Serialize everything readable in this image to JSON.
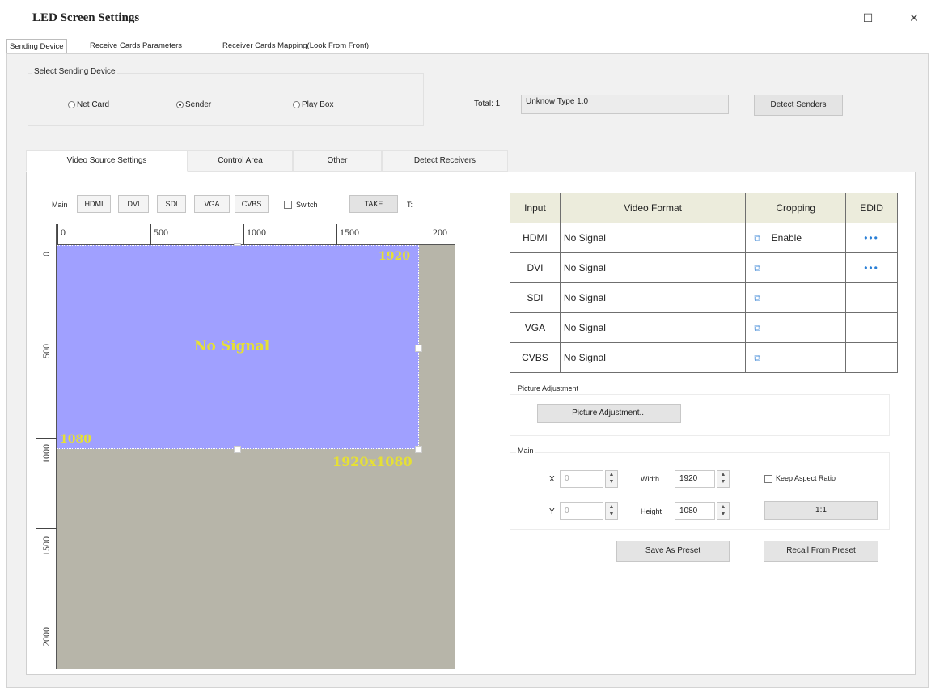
{
  "window": {
    "title": "LED Screen Settings",
    "restore_glyph": "☐",
    "close_glyph": "✕"
  },
  "top_tabs": [
    {
      "label": "Sending Device",
      "active": true
    },
    {
      "label": "Receive Cards Parameters",
      "active": false
    },
    {
      "label": "Receiver Cards Mapping(Look From Front)",
      "active": false
    }
  ],
  "select_sending": {
    "label": "Select Sending Device",
    "options": [
      {
        "label": "Net Card",
        "selected": false
      },
      {
        "label": "Sender",
        "selected": true
      },
      {
        "label": "Play Box",
        "selected": false
      }
    ]
  },
  "total": {
    "label": "Total: 1",
    "value": "Unknow Type 1.0"
  },
  "detect_senders_label": "Detect Senders",
  "sub_tabs": [
    {
      "label": "Video Source Settings",
      "active": true
    },
    {
      "label": "Control Area",
      "active": false
    },
    {
      "label": "Other",
      "active": false
    },
    {
      "label": "Detect Receivers",
      "active": false
    }
  ],
  "source_bar": {
    "main_label": "Main",
    "buttons": [
      "HDMI",
      "DVI",
      "SDI",
      "VGA",
      "CVBS"
    ],
    "switch_label": "Switch",
    "take_label": "TAKE",
    "t_label": "T:"
  },
  "preview": {
    "ruler_h": [
      "0",
      "500",
      "1000",
      "1500",
      "200"
    ],
    "ruler_v": [
      "0",
      "500",
      "1000",
      "1500",
      "2000"
    ],
    "no_signal": "No Signal",
    "width_label": "1920",
    "height_label": "1080",
    "size_label": "1920x1080",
    "colors": {
      "video": "#a0a0ff",
      "background": "#b7b5a9",
      "label": "#e6e034"
    }
  },
  "inputs_table": {
    "headers": [
      "Input",
      "Video Format",
      "Cropping",
      "EDID"
    ],
    "rows": [
      {
        "input": "HDMI",
        "format": "No Signal",
        "cropping": "Enable",
        "edid": "•••"
      },
      {
        "input": "DVI",
        "format": "No Signal",
        "cropping": "",
        "edid": "•••"
      },
      {
        "input": "SDI",
        "format": "No Signal",
        "cropping": "",
        "edid": ""
      },
      {
        "input": "VGA",
        "format": "No Signal",
        "cropping": "",
        "edid": ""
      },
      {
        "input": "CVBS",
        "format": "No Signal",
        "cropping": "",
        "edid": ""
      }
    ]
  },
  "picture_adjustment": {
    "group_label": "Picture Adjustment",
    "button_label": "Picture Adjustment..."
  },
  "main_group": {
    "label": "Main",
    "x_label": "X",
    "x_value": "0",
    "y_label": "Y",
    "y_value": "0",
    "width_label": "Width",
    "width_value": "1920",
    "height_label": "Height",
    "height_value": "1080",
    "keep_aspect_label": "Keep Aspect Ratio",
    "ratio_button": "1:1"
  },
  "save_preset_label": "Save As Preset",
  "recall_preset_label": "Recall From Preset"
}
